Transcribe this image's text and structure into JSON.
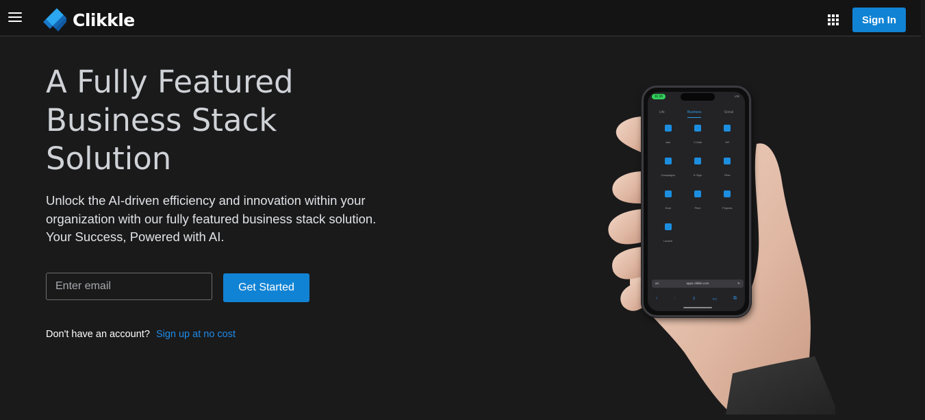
{
  "header": {
    "brand_name": "Clikkle",
    "menu_icon": "hamburger-menu-icon",
    "apps_icon": "apps-grid-icon",
    "signin_label": "Sign In",
    "accent_color": "#1183d4"
  },
  "hero": {
    "title_lines": [
      "A Fully Featured",
      "Business Stack",
      "Solution"
    ],
    "subtitle_lines": [
      "Unlock the AI-driven efficiency and innovation within your",
      "organization with our fully featured business stack solution.",
      "Your Success, Powered with AI."
    ],
    "email_placeholder": "Enter email",
    "email_value": "",
    "cta_label": "Get Started",
    "signup_prompt": "Don't have an account?",
    "signup_link": "Sign up at no cost"
  },
  "phone": {
    "status_time": "11:16",
    "status_signal": "LTE",
    "tabs": [
      {
        "label": "Life",
        "active": false
      },
      {
        "label": "Business",
        "active": true
      },
      {
        "label": "Social",
        "active": false
      }
    ],
    "apps": [
      {
        "label": "Ads",
        "icon": "ads-icon"
      },
      {
        "label": "C-Mail",
        "icon": "mail-icon"
      },
      {
        "label": "HR",
        "icon": "hr-icon"
      },
      {
        "label": "Campaigns",
        "icon": "campaigns-icon"
      },
      {
        "label": "E-Sign",
        "icon": "esign-icon"
      },
      {
        "label": "Files",
        "icon": "files-icon"
      },
      {
        "label": "Host",
        "icon": "host-icon"
      },
      {
        "label": "Pitch",
        "icon": "pitch-icon"
      },
      {
        "label": "Projects",
        "icon": "projects-icon"
      },
      {
        "label": "Launch",
        "icon": "launch-icon"
      }
    ],
    "address_prefix": "aA",
    "address_url": "apps.clikkle.com"
  }
}
